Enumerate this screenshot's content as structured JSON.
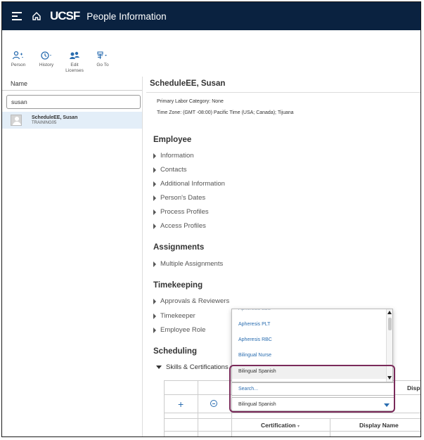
{
  "header": {
    "logo": "UCSF",
    "title": "People Information"
  },
  "toolbar": {
    "items": [
      {
        "label": "Person",
        "icon": "person-icon"
      },
      {
        "label": "History",
        "icon": "history-icon"
      },
      {
        "label": "Edit Licenses",
        "icon": "licenses-icon"
      },
      {
        "label": "Go To",
        "icon": "goto-icon"
      }
    ]
  },
  "sidebar": {
    "column_header": "Name",
    "search_value": "susan",
    "results": [
      {
        "name": "ScheduleEE, Susan",
        "sub": "TRAINING05"
      }
    ]
  },
  "detail": {
    "title": "ScheduleEE, Susan",
    "info": [
      "Primary Labor Category: None",
      "Time Zone: (GMT -08:00) Pacific Time (USA; Canada); Tijuana"
    ],
    "sections": [
      {
        "title": "Employee",
        "items": [
          "Information",
          "Contacts",
          "Additional Information",
          "Person's Dates",
          "Process Profiles",
          "Access Profiles"
        ]
      },
      {
        "title": "Assignments",
        "items": [
          "Multiple Assignments"
        ]
      },
      {
        "title": "Timekeeping",
        "items": [
          "Approvals & Reviewers",
          "Timekeeper",
          "Employee Role"
        ]
      },
      {
        "title": "Scheduling",
        "items": [
          "Skills & Certifications"
        ]
      }
    ]
  },
  "grid": {
    "columns": [
      "Certification",
      "Display Name"
    ],
    "partial_header": "Displ"
  },
  "dropdown": {
    "options": [
      "Apheresis PLT",
      "Apheresis RBC",
      "Bilingual Nurse",
      "Bilingual Spanish"
    ],
    "selected_option": "Bilingual Spanish",
    "search_placeholder": "Search...",
    "current_value": "Bilingual Spanish"
  },
  "colors": {
    "header_bg": "#0a2240",
    "link": "#2a6db0",
    "highlight": "#7a2a5a",
    "selection_bg": "#e3eef8"
  }
}
